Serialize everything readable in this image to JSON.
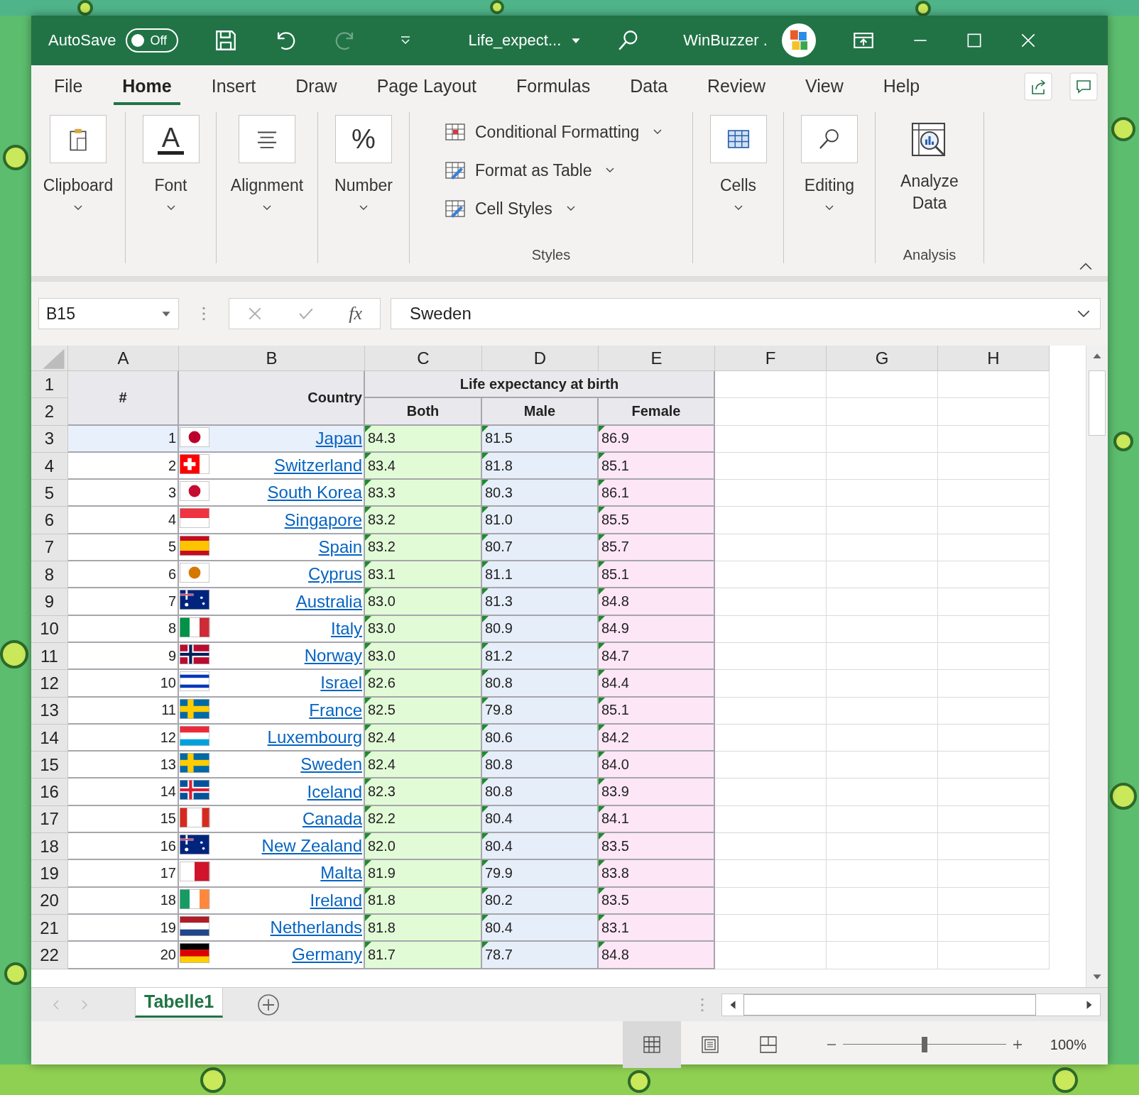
{
  "title_bar": {
    "autosave_label": "AutoSave",
    "autosave": {
      "on": false,
      "label": "Off"
    },
    "redo_disabled": true,
    "file_name": "Life_expect...",
    "user": "WinBuzzer ."
  },
  "ribbon_tabs": [
    {
      "label": "File",
      "selected": false
    },
    {
      "label": "Home",
      "selected": true
    },
    {
      "label": "Insert",
      "selected": false
    },
    {
      "label": "Draw",
      "selected": false
    },
    {
      "label": "Page Layout",
      "selected": false
    },
    {
      "label": "Formulas",
      "selected": false
    },
    {
      "label": "Data",
      "selected": false
    },
    {
      "label": "Review",
      "selected": false
    },
    {
      "label": "View",
      "selected": false
    },
    {
      "label": "Help",
      "selected": false
    }
  ],
  "groups": [
    {
      "kind": "large",
      "label": "Clipboard"
    },
    {
      "kind": "large",
      "label": "Font",
      "glyph": "A"
    },
    {
      "kind": "large",
      "label": "Alignment"
    },
    {
      "kind": "large",
      "label": "Number",
      "glyph": "%"
    },
    {
      "kind": "list",
      "label": "Styles",
      "items": [
        "Conditional Formatting",
        "Format as Table",
        "Cell Styles"
      ]
    },
    {
      "kind": "large",
      "label": "Cells"
    },
    {
      "kind": "large",
      "label": "Editing"
    },
    {
      "kind": "analysis",
      "label": "Analysis",
      "button": "Analyze Data"
    }
  ],
  "formula_bar": {
    "name_box": "B15",
    "fx": "fx",
    "value": "Sweden"
  },
  "columns": [
    "A",
    "B",
    "C",
    "D",
    "E",
    "F",
    "G",
    "H"
  ],
  "row_numbers": [
    "1",
    "2",
    "3",
    "4",
    "5",
    "6",
    "7",
    "8",
    "9",
    "10",
    "11",
    "12",
    "13",
    "14",
    "15",
    "16",
    "17",
    "18",
    "19",
    "20",
    "21",
    "22"
  ],
  "header": {
    "number": "#",
    "country": "Country",
    "group": "Life expectancy at birth",
    "sub": [
      "Both",
      "Male",
      "Female"
    ]
  },
  "rows": [
    {
      "n": "1",
      "country": "Japan",
      "both": "84.3",
      "male": "81.5",
      "female": "86.9",
      "highlighted": true
    },
    {
      "n": "2",
      "country": "Switzerland",
      "both": "83.4",
      "male": "81.8",
      "female": "85.1",
      "highlighted": false
    },
    {
      "n": "3",
      "country": "South Korea",
      "both": "83.3",
      "male": "80.3",
      "female": "86.1",
      "highlighted": false
    },
    {
      "n": "4",
      "country": "Singapore",
      "both": "83.2",
      "male": "81.0",
      "female": "85.5",
      "highlighted": false
    },
    {
      "n": "5",
      "country": "Spain",
      "both": "83.2",
      "male": "80.7",
      "female": "85.7",
      "highlighted": false
    },
    {
      "n": "6",
      "country": "Cyprus",
      "both": "83.1",
      "male": "81.1",
      "female": "85.1",
      "highlighted": false
    },
    {
      "n": "7",
      "country": "Australia",
      "both": "83.0",
      "male": "81.3",
      "female": "84.8",
      "highlighted": false
    },
    {
      "n": "8",
      "country": "Italy",
      "both": "83.0",
      "male": "80.9",
      "female": "84.9",
      "highlighted": false
    },
    {
      "n": "9",
      "country": "Norway",
      "both": "83.0",
      "male": "81.2",
      "female": "84.7",
      "highlighted": false
    },
    {
      "n": "10",
      "country": "Israel",
      "both": "82.6",
      "male": "80.8",
      "female": "84.4",
      "highlighted": false
    },
    {
      "n": "11",
      "country": "France",
      "both": "82.5",
      "male": "79.8",
      "female": "85.1",
      "highlighted": false
    },
    {
      "n": "12",
      "country": "Luxembourg",
      "both": "82.4",
      "male": "80.6",
      "female": "84.2",
      "highlighted": false
    },
    {
      "n": "13",
      "country": "Sweden",
      "both": "82.4",
      "male": "80.8",
      "female": "84.0",
      "highlighted": false
    },
    {
      "n": "14",
      "country": "Iceland",
      "both": "82.3",
      "male": "80.8",
      "female": "83.9",
      "highlighted": false
    },
    {
      "n": "15",
      "country": "Canada",
      "both": "82.2",
      "male": "80.4",
      "female": "84.1",
      "highlighted": false
    },
    {
      "n": "16",
      "country": "New Zealand",
      "both": "82.0",
      "male": "80.4",
      "female": "83.5",
      "highlighted": false
    },
    {
      "n": "17",
      "country": "Malta",
      "both": "81.9",
      "male": "79.9",
      "female": "83.8",
      "highlighted": false
    },
    {
      "n": "18",
      "country": "Ireland",
      "both": "81.8",
      "male": "80.2",
      "female": "83.5",
      "highlighted": false
    },
    {
      "n": "19",
      "country": "Netherlands",
      "both": "81.8",
      "male": "80.4",
      "female": "83.1",
      "highlighted": false
    },
    {
      "n": "20",
      "country": "Germany",
      "both": "81.7",
      "male": "78.7",
      "female": "84.8",
      "highlighted": false
    }
  ],
  "sheet_tabs": [
    {
      "label": "Tabelle1",
      "selected": true
    }
  ],
  "status_bar": {
    "views": [
      {
        "selected": true
      },
      {
        "selected": false
      },
      {
        "selected": false
      }
    ],
    "zoom": {
      "level": 0.5
    },
    "zoom_label": "100%"
  }
}
